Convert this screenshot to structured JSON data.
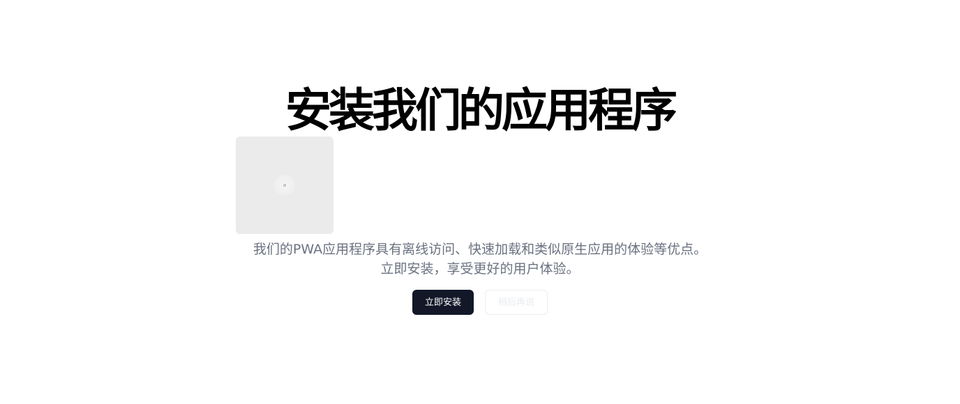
{
  "page": {
    "title": "安装我们的应用程序",
    "description_line1": "我们的PWA应用程序具有离线访问、快速加载和类似原生应用的体验等优点。",
    "description_line2": "立即安装，享受更好的用户体验。"
  },
  "app_icon": {
    "icon_name": "app-icon-placeholder"
  },
  "buttons": {
    "install_label": "立即安装",
    "later_label": "稍后再说"
  },
  "colors": {
    "primary_button": "#121828",
    "description_text": "#6b7280",
    "icon_placeholder": "#ebebeb"
  }
}
